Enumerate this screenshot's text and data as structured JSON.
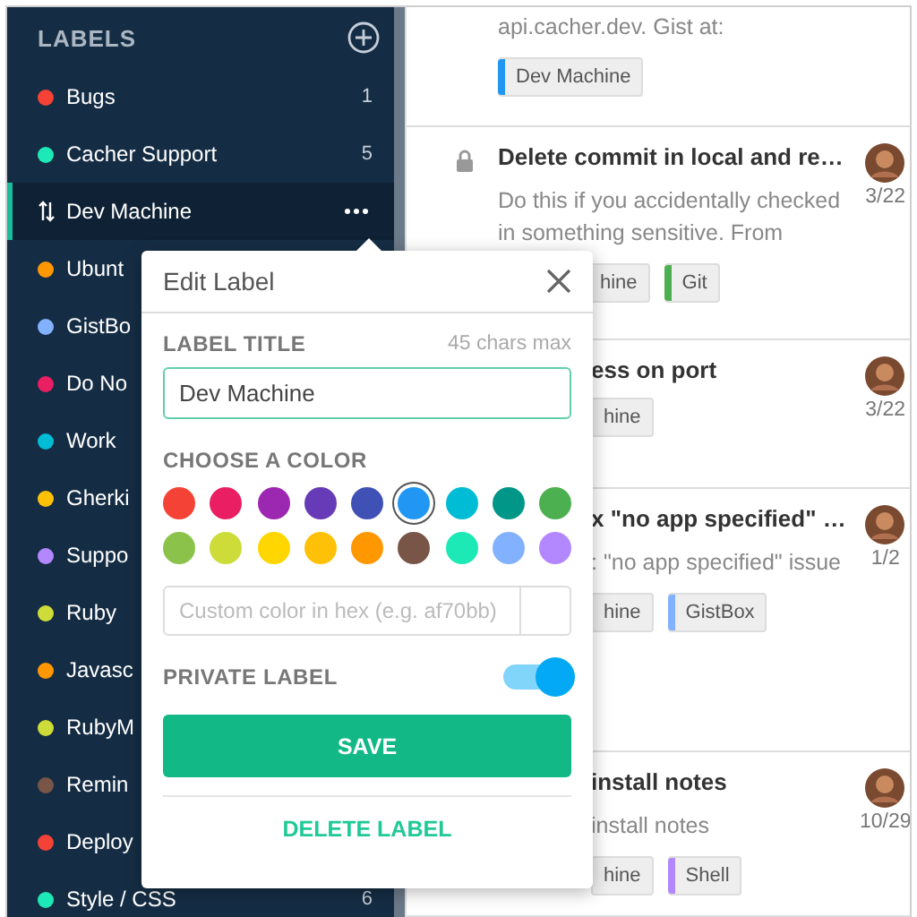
{
  "sidebar": {
    "title": "LABELS",
    "items": [
      {
        "name": "Bugs",
        "color": "#f44336",
        "count": "1",
        "selected": false
      },
      {
        "name": "Cacher Support",
        "color": "#1de9b6",
        "count": "5",
        "selected": false
      },
      {
        "name": "Dev Machine",
        "selected": true
      },
      {
        "name": "Ubunt",
        "color": "#ff9800",
        "selected": false
      },
      {
        "name": "GistBo",
        "color": "#82b1ff",
        "selected": false
      },
      {
        "name": "Do No",
        "color": "#e91e63",
        "selected": false
      },
      {
        "name": "Work",
        "color": "#00bcd4",
        "selected": false
      },
      {
        "name": "Gherki",
        "color": "#ffc107",
        "selected": false
      },
      {
        "name": "Suppo",
        "color": "#b388ff",
        "selected": false
      },
      {
        "name": "Ruby",
        "color": "#cddc39",
        "selected": false
      },
      {
        "name": "Javasc",
        "color": "#ff9800",
        "selected": false
      },
      {
        "name": "RubyM",
        "color": "#cddc39",
        "selected": false
      },
      {
        "name": "Remin",
        "color": "#795548",
        "selected": false
      },
      {
        "name": "Deploy",
        "color": "#f44336",
        "selected": false
      },
      {
        "name": "Style / CSS",
        "color": "#1de9b6",
        "count": "6",
        "selected": false
      }
    ]
  },
  "notes": [
    {
      "body": "api.cacher.dev. Gist at:",
      "tags": [
        {
          "label": "Dev Machine",
          "color": "#2196f3"
        }
      ]
    },
    {
      "locked": true,
      "title": "Delete commit in local and re…",
      "body": "Do this if you accidentally checked in something sensitive. From",
      "date": "3/22",
      "tags": [
        {
          "label": "hine"
        },
        {
          "label": "Git",
          "color": "#4caf50"
        }
      ]
    },
    {
      "title": "ess on port",
      "date": "3/22",
      "tags": [
        {
          "label": "hine"
        }
      ]
    },
    {
      "title": "x \"no app specified\" …",
      "body": ": \"no app specified\" issue",
      "date": "1/2",
      "tags": [
        {
          "label": "hine"
        },
        {
          "label": "GistBox",
          "color": "#82b1ff"
        }
      ]
    },
    {
      "title": "install notes",
      "body": "install notes",
      "date": "10/29",
      "tags": [
        {
          "label": "hine"
        },
        {
          "label": "Shell",
          "color": "#b388ff"
        }
      ]
    }
  ],
  "dialog": {
    "title": "Edit Label",
    "title_label": "LABEL TITLE",
    "limit": "45 chars max",
    "title_value": "Dev Machine",
    "color_label": "CHOOSE A COLOR",
    "colors": [
      {
        "color": "#f44336",
        "selected": false
      },
      {
        "color": "#e91e63",
        "selected": false
      },
      {
        "color": "#9c27b0",
        "selected": false
      },
      {
        "color": "#673ab7",
        "selected": false
      },
      {
        "color": "#3f51b5",
        "selected": false
      },
      {
        "color": "#2196f3",
        "selected": true
      },
      {
        "color": "#00bcd4",
        "selected": false
      },
      {
        "color": "#009688",
        "selected": false
      },
      {
        "color": "#4caf50",
        "selected": false
      },
      {
        "color": "#8bc34a",
        "selected": false
      },
      {
        "color": "#cddc39",
        "selected": false
      },
      {
        "color": "#ffd600",
        "selected": false
      },
      {
        "color": "#ffc107",
        "selected": false
      },
      {
        "color": "#ff9800",
        "selected": false
      },
      {
        "color": "#795548",
        "selected": false
      },
      {
        "color": "#1de9b6",
        "selected": false
      },
      {
        "color": "#82b1ff",
        "selected": false
      },
      {
        "color": "#b388ff",
        "selected": false
      }
    ],
    "custom_placeholder": "Custom color in hex (e.g. af70bb)",
    "private_label": "PRIVATE LABEL",
    "private_on": true,
    "save": "SAVE",
    "delete": "DELETE LABEL"
  }
}
